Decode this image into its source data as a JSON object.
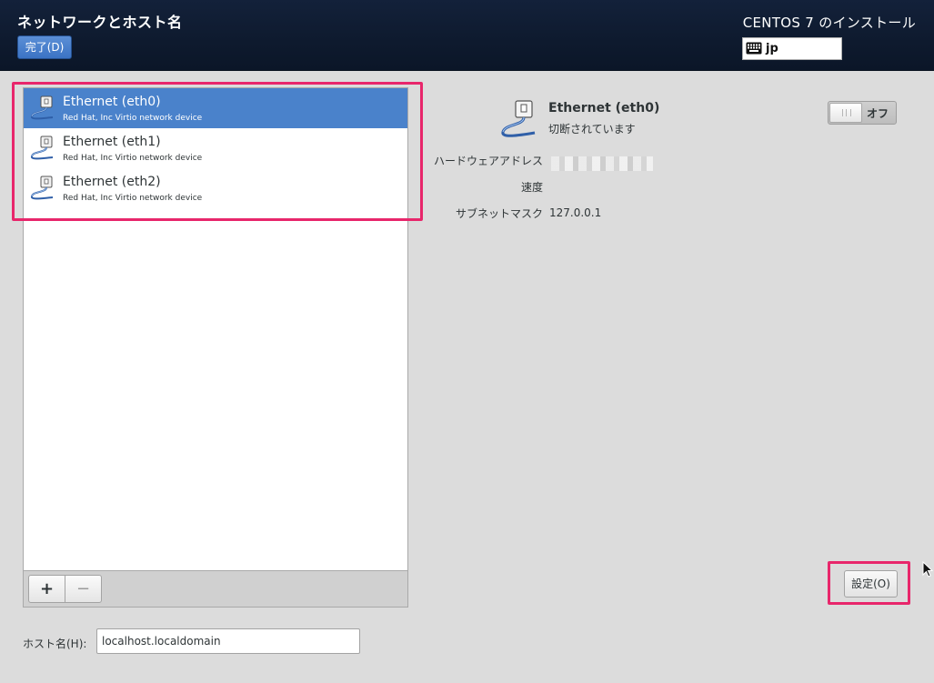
{
  "header": {
    "title": "ネットワークとホスト名",
    "done_label": "完了(D)",
    "install_title": "CENTOS 7 のインストール",
    "keyboard_layout": "jp"
  },
  "devices": [
    {
      "name": "Ethernet (eth0)",
      "description": "Red Hat, Inc Virtio network device",
      "selected": true
    },
    {
      "name": "Ethernet (eth1)",
      "description": "Red Hat, Inc Virtio network device",
      "selected": false
    },
    {
      "name": "Ethernet (eth2)",
      "description": "Red Hat, Inc Virtio network device",
      "selected": false
    }
  ],
  "list_toolbar": {
    "add_label": "+",
    "remove_label": "−"
  },
  "detail": {
    "name": "Ethernet (eth0)",
    "status": "切断されています",
    "toggle_label": "オフ",
    "toggle_on": false,
    "properties": {
      "hw_address_label": "ハードウェアアドレス",
      "speed_label": "速度",
      "subnet_label": "サブネットマスク",
      "subnet_value": "127.0.0.1"
    },
    "configure_label": "設定(O)"
  },
  "hostname": {
    "label": "ホスト名(H):",
    "value": "localhost.localdomain"
  },
  "colors": {
    "header_bg": "#0e1a2e",
    "selection": "#4a82cb",
    "accent_button": "#3b73c4",
    "highlight": "#e8266b"
  },
  "icons": {
    "device": "ethernet-cable-icon",
    "keyboard": "keyboard-icon",
    "cursor": "mouse-cursor-icon"
  }
}
